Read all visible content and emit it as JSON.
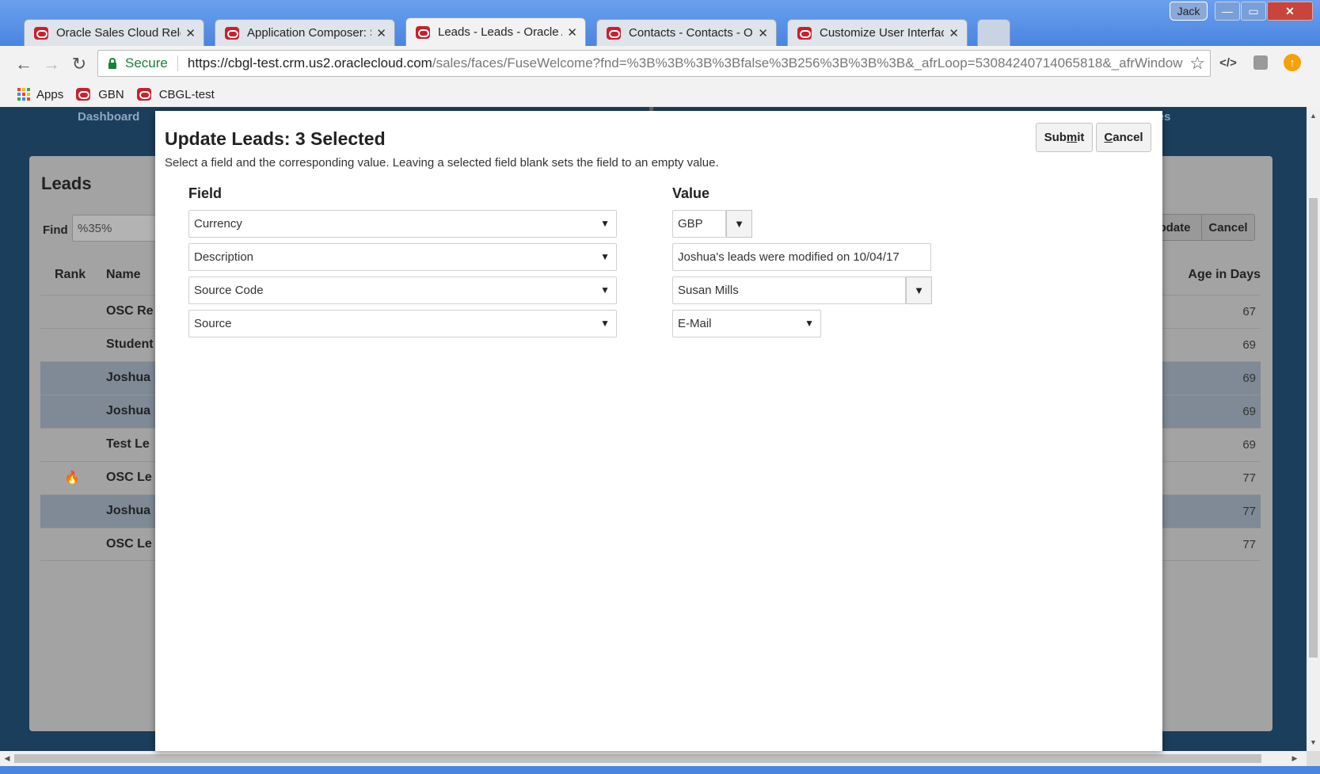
{
  "browser": {
    "tabs": [
      {
        "title": "Oracle Sales Cloud Release",
        "active": false
      },
      {
        "title": "Application Composer: S",
        "active": false
      },
      {
        "title": "Leads - Leads - Oracle Ap",
        "active": true
      },
      {
        "title": "Contacts - Contacts - Ora",
        "active": false
      },
      {
        "title": "Customize User Interface",
        "active": false
      }
    ],
    "tab_close_glyph": "✕",
    "user_badge": "Jack",
    "window_controls": {
      "minimize": "—",
      "maximize": "▭",
      "close": "✕"
    },
    "secure_label": "Secure",
    "url_host": "https://cbgl-test.crm.us2.oraclecloud.com",
    "url_rest": "/sales/faces/FuseWelcome?fnd=%3B%3B%3B%3Bfalse%3B256%3B%3B%3B&_afrLoop=53084240714065818&_afrWindow",
    "nav_glyphs": {
      "back": "←",
      "forward": "→",
      "reload": "↻",
      "star": "☆",
      "devtools": "</>"
    },
    "ext_orange_glyph": "↑",
    "bookmarks": [
      {
        "label": "Apps",
        "icon": "apps-grid-icon"
      },
      {
        "label": "GBN",
        "icon": "oracle-icon"
      },
      {
        "label": "CBGL-test",
        "icon": "oracle-icon"
      }
    ]
  },
  "background_page": {
    "nav": {
      "dashboard": "Dashboard",
      "activities": "vities"
    },
    "leads_title": "Leads",
    "find_label": "Find",
    "find_value": "%35%",
    "buttons": {
      "update": "pdate",
      "cancel": "Cancel"
    },
    "columns": {
      "rank": "Rank",
      "name": "Name",
      "age": "Age in Days"
    },
    "rows": [
      {
        "rank": "",
        "name": "OSC Re",
        "age": "67",
        "selected": false
      },
      {
        "rank": "",
        "name": "Student",
        "age": "69",
        "selected": false
      },
      {
        "rank": "",
        "name": "Joshua",
        "age": "69",
        "selected": true
      },
      {
        "rank": "",
        "name": "Joshua",
        "age": "69",
        "selected": true
      },
      {
        "rank": "",
        "name": "Test Le",
        "age": "69",
        "selected": false
      },
      {
        "rank": "🔥",
        "name": "OSC Le",
        "age": "77",
        "selected": false
      },
      {
        "rank": "",
        "name": "Joshua",
        "age": "77",
        "selected": true
      },
      {
        "rank": "",
        "name": "OSC Le",
        "age": "77",
        "selected": false
      }
    ]
  },
  "modal": {
    "title": "Update Leads: 3 Selected",
    "description": "Select a field and the corresponding value. Leaving a selected field blank sets the field to an empty value.",
    "submit_pre": "Sub",
    "submit_mnemonic": "m",
    "submit_post": "it",
    "cancel_mnemonic": "C",
    "cancel_rest": "ancel",
    "field_header": "Field",
    "value_header": "Value",
    "caret": "▼",
    "rows": [
      {
        "field": "Currency",
        "value": "GBP",
        "value_type": "dropdown-button"
      },
      {
        "field": "Description",
        "value": "Joshua's leads were modified on 10/04/17",
        "value_type": "text"
      },
      {
        "field": "Source Code",
        "value": "Susan Mills",
        "value_type": "dropdown-button"
      },
      {
        "field": "Source",
        "value": "E-Mail",
        "value_type": "select"
      }
    ]
  },
  "colors": {
    "titlebar": "#4a85df",
    "page_background": "#1b3e5c",
    "selected_row": "#7f8a96",
    "secure_green": "#188038",
    "oracle_red": "#c8202e"
  }
}
